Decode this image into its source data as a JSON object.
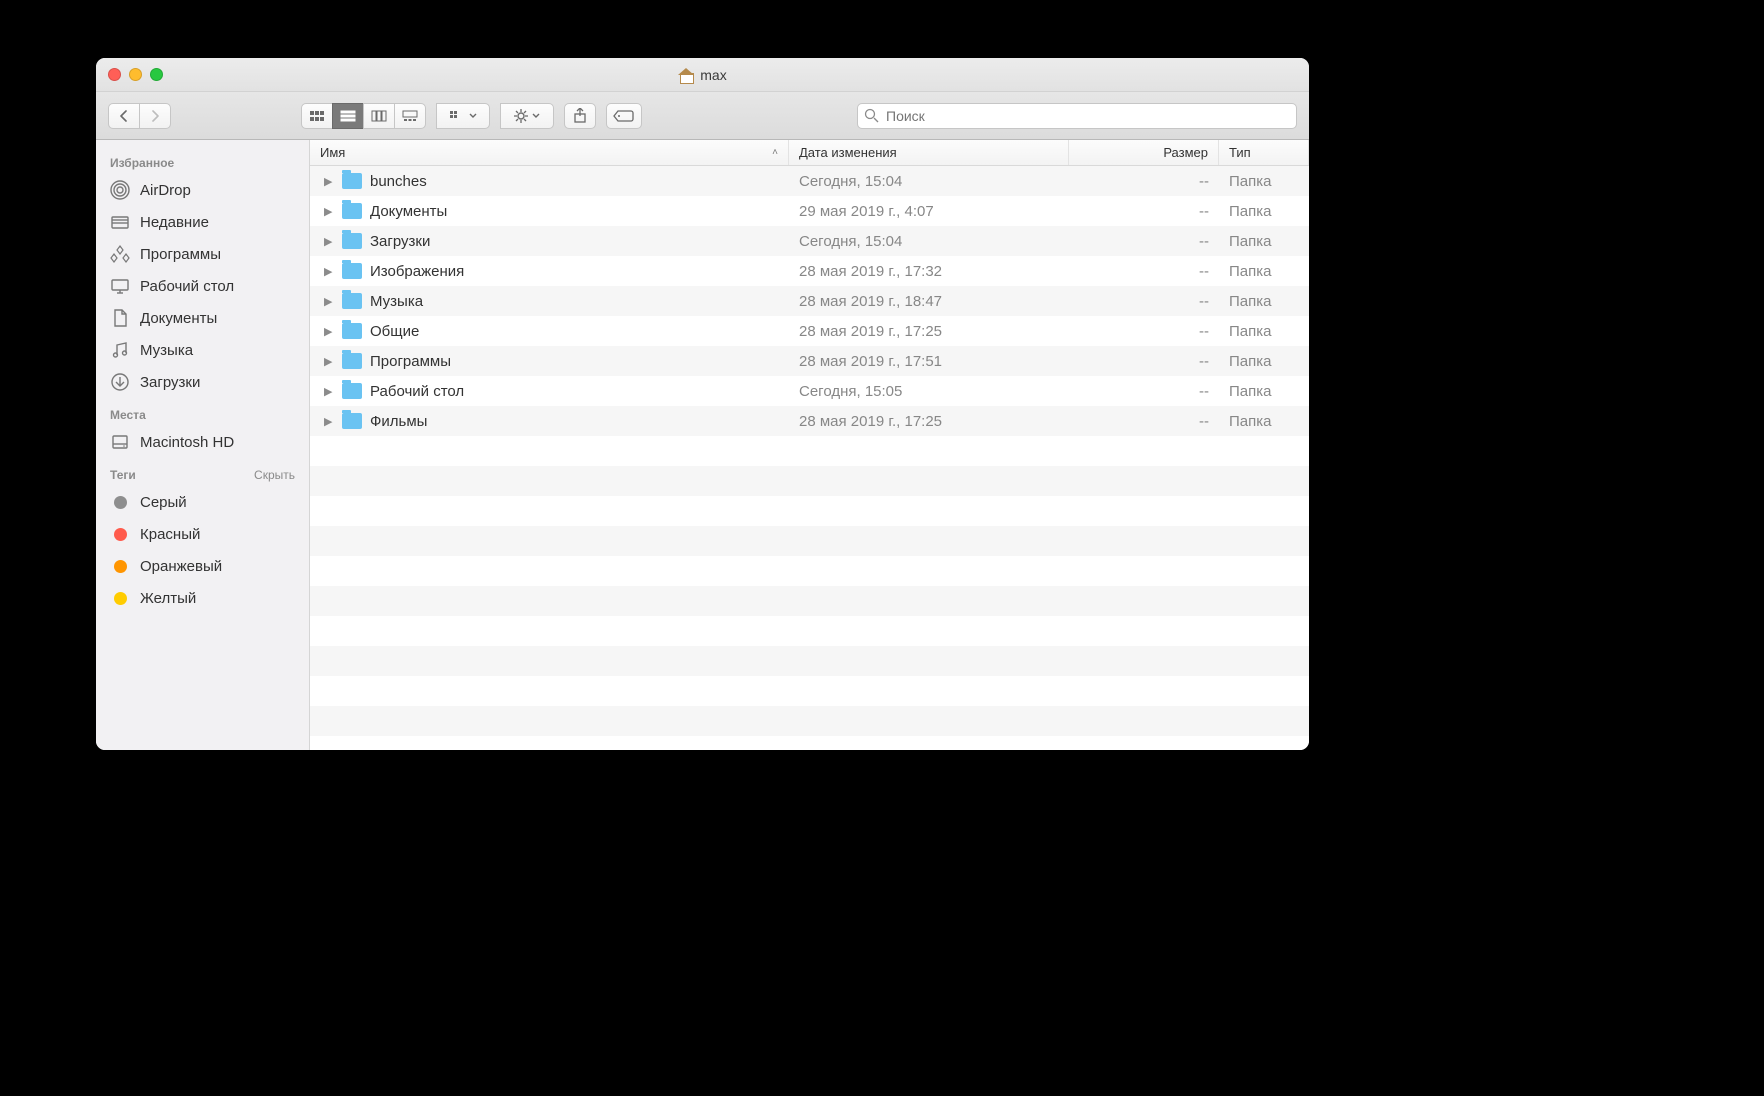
{
  "window": {
    "title": "max"
  },
  "toolbar": {
    "search_placeholder": "Поиск"
  },
  "sidebar": {
    "sections": [
      {
        "title": "Избранное",
        "hide": "",
        "items": [
          {
            "icon": "airdrop",
            "label": "AirDrop"
          },
          {
            "icon": "recent",
            "label": "Недавние"
          },
          {
            "icon": "apps",
            "label": "Программы"
          },
          {
            "icon": "desktop",
            "label": "Рабочий стол"
          },
          {
            "icon": "documents",
            "label": "Документы"
          },
          {
            "icon": "music",
            "label": "Музыка"
          },
          {
            "icon": "downloads",
            "label": "Загрузки"
          }
        ]
      },
      {
        "title": "Места",
        "hide": "",
        "items": [
          {
            "icon": "disk",
            "label": "Macintosh HD"
          }
        ]
      },
      {
        "title": "Теги",
        "hide": "Скрыть",
        "items": [
          {
            "icon": "tag",
            "color": "#8e8e8e",
            "label": "Серый"
          },
          {
            "icon": "tag",
            "color": "#ff5b4c",
            "label": "Красный"
          },
          {
            "icon": "tag",
            "color": "#ff9500",
            "label": "Оранжевый"
          },
          {
            "icon": "tag",
            "color": "#ffcc00",
            "label": "Желтый"
          }
        ]
      }
    ]
  },
  "columns": {
    "name": "Имя",
    "date": "Дата изменения",
    "size": "Размер",
    "kind": "Тип",
    "sort_indicator": "˄"
  },
  "rows": [
    {
      "name": "bunches",
      "date": "Сегодня, 15:04",
      "size": "--",
      "kind": "Папка"
    },
    {
      "name": "Документы",
      "date": "29 мая 2019 г., 4:07",
      "size": "--",
      "kind": "Папка"
    },
    {
      "name": "Загрузки",
      "date": "Сегодня, 15:04",
      "size": "--",
      "kind": "Папка"
    },
    {
      "name": "Изображения",
      "date": "28 мая 2019 г., 17:32",
      "size": "--",
      "kind": "Папка"
    },
    {
      "name": "Музыка",
      "date": "28 мая 2019 г., 18:47",
      "size": "--",
      "kind": "Папка"
    },
    {
      "name": "Общие",
      "date": "28 мая 2019 г., 17:25",
      "size": "--",
      "kind": "Папка"
    },
    {
      "name": "Программы",
      "date": "28 мая 2019 г., 17:51",
      "size": "--",
      "kind": "Папка"
    },
    {
      "name": "Рабочий стол",
      "date": "Сегодня, 15:05",
      "size": "--",
      "kind": "Папка"
    },
    {
      "name": "Фильмы",
      "date": "28 мая 2019 г., 17:25",
      "size": "--",
      "kind": "Папка"
    }
  ]
}
